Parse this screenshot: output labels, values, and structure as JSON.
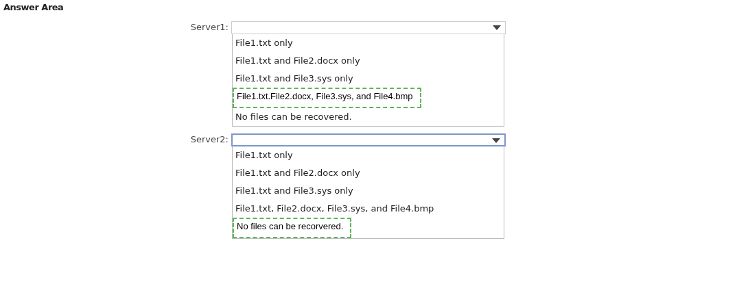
{
  "title": "Answer Area",
  "dropdowns": [
    {
      "label": "Server1:",
      "focused": false,
      "options": [
        {
          "text": "File1.txt only",
          "selected": false
        },
        {
          "text": "File1.txt and File2.docx only",
          "selected": false
        },
        {
          "text": "File1.txt and File3.sys only",
          "selected": false
        },
        {
          "text": "File1.txt.File2.docx, File3.sys, and File4.bmp",
          "selected": true
        },
        {
          "text": "No files can be recovered.",
          "selected": false
        }
      ]
    },
    {
      "label": "Server2:",
      "focused": true,
      "options": [
        {
          "text": "File1.txt only",
          "selected": false
        },
        {
          "text": "File1.txt and File2.docx only",
          "selected": false
        },
        {
          "text": "File1.txt and File3.sys only",
          "selected": false
        },
        {
          "text": "File1.txt, File2.docx, File3.sys, and File4.bmp",
          "selected": false
        },
        {
          "text": "No files can be recorvered.",
          "selected": true
        }
      ]
    }
  ]
}
